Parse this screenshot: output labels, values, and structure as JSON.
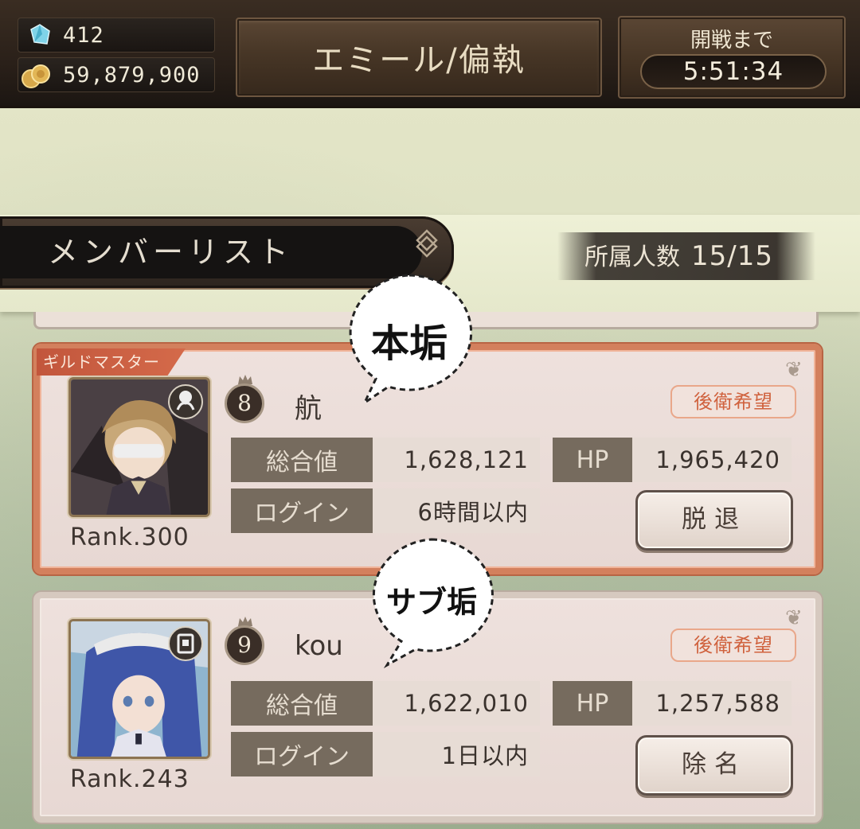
{
  "top_bar": {
    "gems": "412",
    "gold": "59,879,900",
    "title": "エミール/偏執",
    "timer_label": "開戦まで",
    "timer_value": "5:51:34"
  },
  "member_list": {
    "title": "メンバーリスト",
    "count_label": "所属人数",
    "count_value": "15/15"
  },
  "members": [
    {
      "ribbon": "ギルドマスター",
      "level": "8",
      "name": "航",
      "preference": "後衛希望",
      "total_label": "総合値",
      "total_value": "1,628,121",
      "hp_label": "HP",
      "hp_value": "1,965,420",
      "login_label": "ログイン",
      "login_value": "6時間以内",
      "rank": "Rank.300",
      "action": "脱退",
      "role_icon": "tentacle-icon"
    },
    {
      "level": "9",
      "name": "kou",
      "preference": "後衛希望",
      "total_label": "総合値",
      "total_value": "1,622,010",
      "hp_label": "HP",
      "hp_value": "1,257,588",
      "login_label": "ログイン",
      "login_value": "1日以内",
      "rank": "Rank.243",
      "action": "除名",
      "role_icon": "book-icon"
    }
  ],
  "annotations": {
    "main_account": "本垢",
    "sub_account": "サブ垢"
  }
}
